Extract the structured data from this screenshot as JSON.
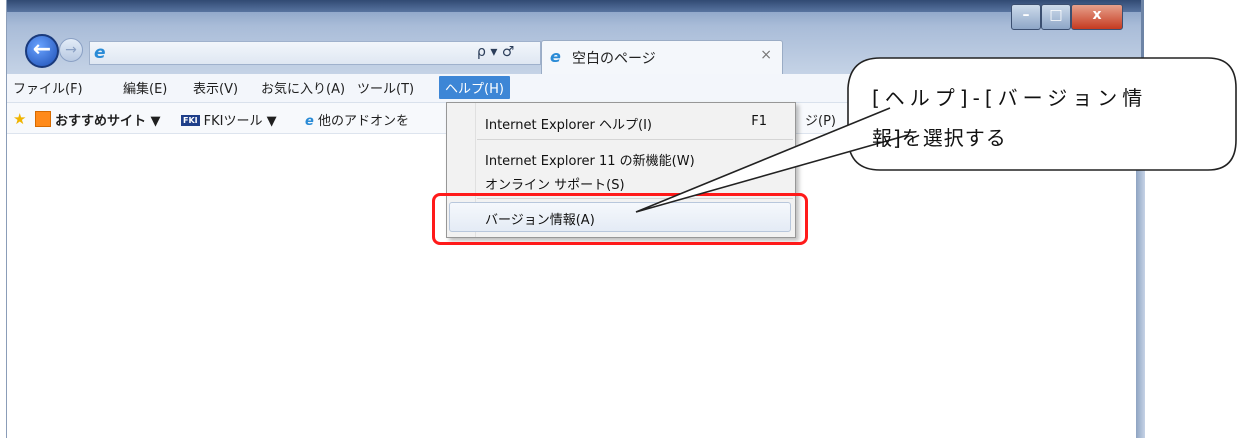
{
  "browser": {
    "tab_title": "空白のページ",
    "tab_close": "×",
    "address_controls": "ρ ▾ ♂"
  },
  "menubar": {
    "items": [
      "ファイル(F)",
      "編集(E)",
      "表示(V)",
      "お気に入り(A)",
      "ツール(T)",
      "ヘルプ(H)"
    ],
    "active_index": 5
  },
  "favorites": {
    "item1": "おすすめサイト ▼",
    "item2": "FKIツール ▼",
    "item3": "他のアドオンを",
    "fki_badge": "FKI",
    "partial_right": "ジ(P)"
  },
  "help_menu": {
    "items": [
      {
        "label": "Internet Explorer ヘルプ(I)",
        "shortcut": "F1"
      },
      {
        "label": "Internet Explorer 11 の新機能(W)"
      },
      {
        "label": "オンライン サポート(S)"
      },
      {
        "label": "バージョン情報(A)"
      }
    ],
    "highlighted_index": 3
  },
  "callout": {
    "line1": "[ヘルプ]-[バージョン情",
    "line2": "報]を選択する"
  },
  "colors": {
    "highlight_border": "#ff1a1a",
    "active_menu": "#3d86d6"
  }
}
